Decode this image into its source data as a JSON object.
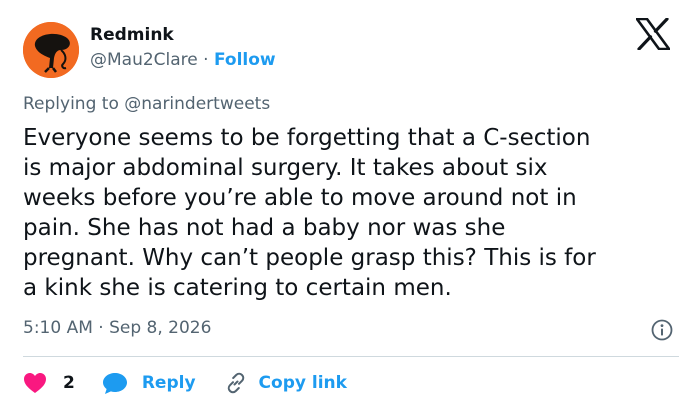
{
  "author": {
    "display_name": "Redmink",
    "handle": "@Mau2Clare",
    "separator": "·",
    "follow_label": "Follow",
    "avatar_color": "#f26a21"
  },
  "reply_to": {
    "prefix": "Replying to",
    "handle": "@narindertweets"
  },
  "tweet": {
    "text": "Everyone seems to be forgetting that a C-section\nis major abdominal surgery. It takes about six\nweeks before you’re able to move around not in\npain. She has not had a baby nor was she\npregnant. Why can’t people grasp this? This is for\na kink she is catering to certain men.",
    "time": "5:10 AM",
    "separator": "·",
    "date": "Sep 8, 2026"
  },
  "actions": {
    "like_count": "2",
    "reply_label": "Reply",
    "copy_link_label": "Copy link"
  },
  "icons": {
    "brand": "x-logo-icon",
    "info": "info-icon",
    "like": "heart-icon",
    "reply": "speech-bubble-icon",
    "copy": "link-icon"
  },
  "colors": {
    "accent": "#1d9bf0",
    "like": "#f91880",
    "muted": "#536471",
    "text": "#0f1419"
  }
}
